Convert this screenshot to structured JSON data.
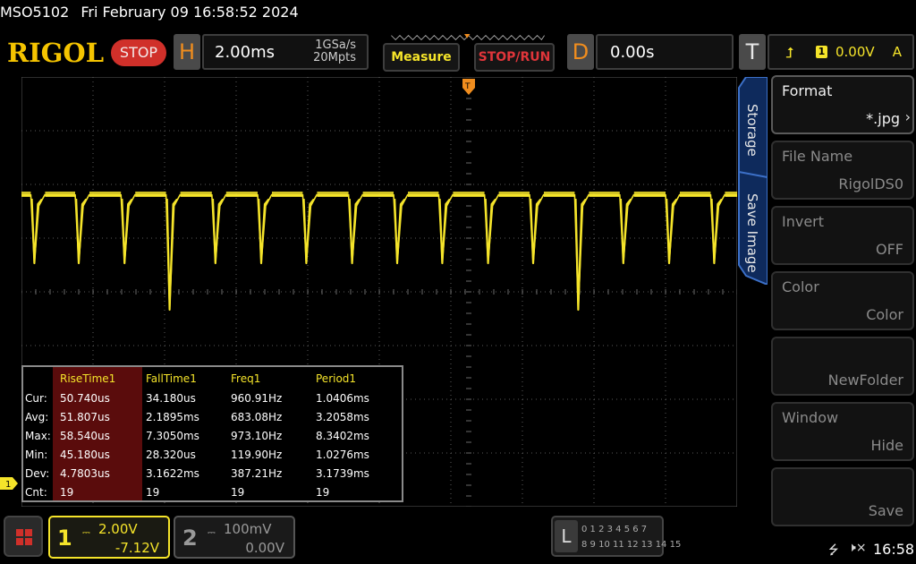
{
  "status": {
    "model": "MSO5102",
    "datetime": "Fri February 09 16:58:52 2024"
  },
  "toolbar": {
    "logo": "RIGOL",
    "run_state": "STOP",
    "horizontal": {
      "letter": "H",
      "timebase": "2.00ms",
      "sample_rate": "1GSa/s",
      "memory_depth": "20Mpts"
    },
    "measure_label": "Measure",
    "stoprun_label": "STOP/RUN",
    "delay": {
      "letter": "D",
      "value": "0.00s"
    },
    "trigger": {
      "letter": "T",
      "slope_icon": "rising-edge-icon",
      "source": "1",
      "level": "0.00V",
      "mode": "A"
    }
  },
  "measurements": {
    "headers": [
      "RiseTime1",
      "FallTime1",
      "Freq1",
      "Period1"
    ],
    "rows": [
      {
        "label": "Cur:",
        "values": [
          "50.740us",
          "34.180us",
          "960.91Hz",
          "1.0406ms"
        ]
      },
      {
        "label": "Avg:",
        "values": [
          "51.807us",
          "2.1895ms",
          "683.08Hz",
          "3.2058ms"
        ]
      },
      {
        "label": "Max:",
        "values": [
          "58.540us",
          "7.3050ms",
          "973.10Hz",
          "8.3402ms"
        ]
      },
      {
        "label": "Min:",
        "values": [
          "45.180us",
          "28.320us",
          "119.90Hz",
          "1.0276ms"
        ]
      },
      {
        "label": "Dev:",
        "values": [
          "4.7803us",
          "3.1622ms",
          "387.21Hz",
          "3.1739ms"
        ]
      },
      {
        "label": "Cnt:",
        "values": [
          "19",
          "19",
          "19",
          "19"
        ]
      }
    ]
  },
  "side_tabs": [
    "Storage",
    "Save Image"
  ],
  "side_menu": [
    {
      "title": "Format",
      "value": "*.jpg",
      "active": true
    },
    {
      "title": "File Name",
      "value": "RigolDS0",
      "active": false
    },
    {
      "title": "Invert",
      "value": "OFF",
      "active": false
    },
    {
      "title": "Color",
      "value": "Color",
      "active": false
    },
    {
      "title": "",
      "value": "NewFolder",
      "active": false
    },
    {
      "title": "Window",
      "value": "Hide",
      "active": false
    },
    {
      "title": "",
      "value": "Save",
      "active": false
    }
  ],
  "channels": [
    {
      "num": "1",
      "coupling_icon": "dc-coupling-icon",
      "scale": "2.00V",
      "offset": "-7.12V",
      "color": "#f5e42a",
      "active": true
    },
    {
      "num": "2",
      "coupling_icon": "dc-coupling-icon",
      "scale": "100mV",
      "offset": "0.00V",
      "color": "#999999",
      "active": false
    }
  ],
  "logic": {
    "letter": "L",
    "row1": "0 1 2 3  4 5 6 7",
    "row2": "8 9 10 11 12 13 14 15"
  },
  "clock": "16:58",
  "trace_color": "#f5e42a",
  "waveform": {
    "pulse_times_div": [
      0.18,
      0.8,
      1.44,
      2.07,
      2.71,
      3.35,
      3.98,
      4.62,
      5.25,
      5.88,
      6.52,
      7.15,
      7.78,
      8.41,
      9.05,
      9.68
    ],
    "deep_pulse_indices": [
      3,
      12
    ]
  }
}
